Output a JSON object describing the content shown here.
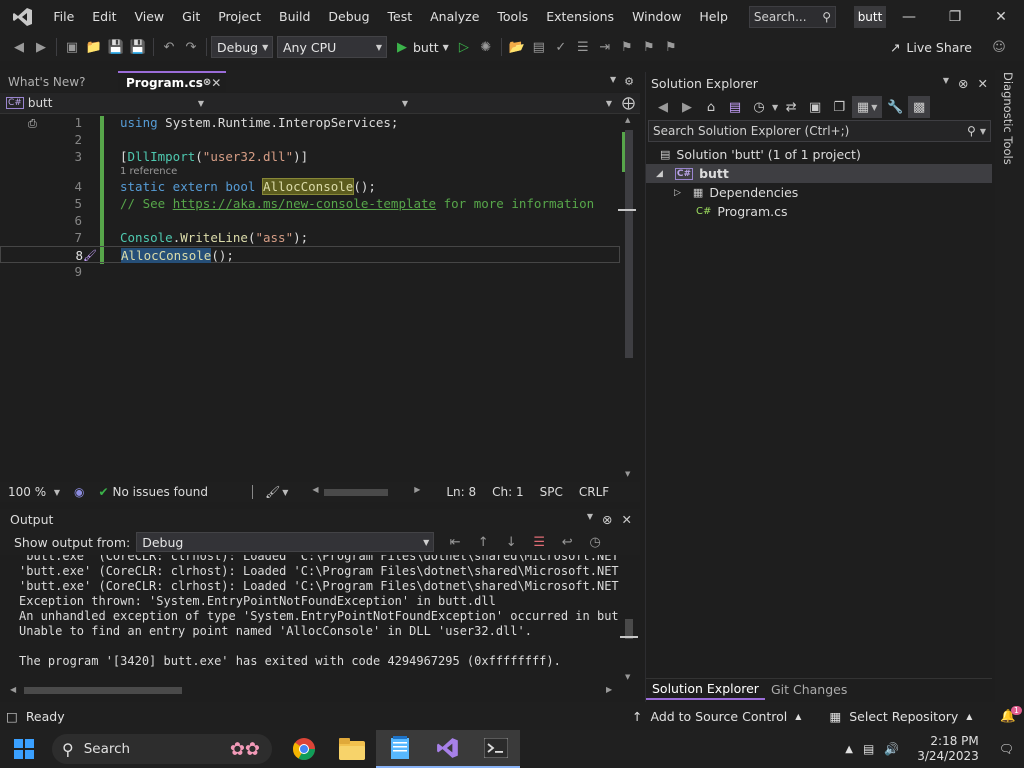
{
  "menu": {
    "items": [
      "File",
      "Edit",
      "View",
      "Git",
      "Project",
      "Build",
      "Debug",
      "Test",
      "Analyze",
      "Tools",
      "Extensions",
      "Window",
      "Help"
    ],
    "search_placeholder": "Search...",
    "solution_name": "butt"
  },
  "toolbar": {
    "config": "Debug",
    "platform": "Any CPU",
    "run_target": "butt",
    "live_share": "Live Share"
  },
  "tabs": [
    {
      "label": "What's New?"
    },
    {
      "label": "Program.cs"
    }
  ],
  "navbar": {
    "project": "butt"
  },
  "editor": {
    "reference_hint": "1 reference",
    "line_numbers": [
      "1",
      "2",
      "3",
      "4",
      "5",
      "6",
      "7",
      "8",
      "9"
    ],
    "l1_kw": "using",
    "l1_rest": " System.Runtime.InteropServices;",
    "l3_open": "[",
    "l3_attr": "DllImport",
    "l3_paren": "(",
    "l3_str": "\"user32.dll\"",
    "l3_close": ")]",
    "l4_kw": "static extern bool",
    "l4_space": " ",
    "l4_fn": "AllocConsole",
    "l4_end": "();",
    "l5_comment": "// See ",
    "l5_link": "https://aka.ms/new-console-template",
    "l5_tail": " for more information",
    "l7_type": "Console",
    "l7_dot": ".",
    "l7_fn": "WriteLine",
    "l7_paren": "(",
    "l7_str": "\"ass\"",
    "l7_end": ");",
    "l8_fn": "AllocConsole",
    "l8_end": "();"
  },
  "status_row": {
    "zoom": "100 %",
    "issues": "No issues found",
    "line": "Ln: 8",
    "col": "Ch: 1",
    "spc": "SPC",
    "eol": "CRLF"
  },
  "output": {
    "title": "Output",
    "show_from_label": "Show output from:",
    "source": "Debug",
    "lines": [
      "'butt.exe' (CoreCLR: clrhost): Loaded 'C:\\Program Files\\dotnet\\shared\\Microsoft.NETCor",
      "'butt.exe' (CoreCLR: clrhost): Loaded 'C:\\Program Files\\dotnet\\shared\\Microsoft.NETCor",
      "'butt.exe' (CoreCLR: clrhost): Loaded 'C:\\Program Files\\dotnet\\shared\\Microsoft.NETCor",
      "Exception thrown: 'System.EntryPointNotFoundException' in butt.dll",
      "An unhandled exception of type 'System.EntryPointNotFoundException' occurred in butt.d",
      "Unable to find an entry point named 'AllocConsole' in DLL 'user32.dll'.",
      "",
      "The program '[3420] butt.exe' has exited with code 4294967295 (0xffffffff)."
    ]
  },
  "solution_explorer": {
    "title": "Solution Explorer",
    "search_placeholder": "Search Solution Explorer (Ctrl+;)",
    "solution_label": "Solution 'butt' (1 of 1 project)",
    "project": "butt",
    "dependencies": "Dependencies",
    "file": "Program.cs",
    "tab_active": "Solution Explorer",
    "tab_other": "Git Changes"
  },
  "diagnostic_tools": "Diagnostic Tools",
  "statusbar": {
    "ready": "Ready",
    "add_source": "Add to Source Control",
    "select_repo": "Select Repository",
    "notif_count": "1"
  },
  "taskbar": {
    "search": "Search",
    "time": "2:18 PM",
    "date": "3/24/2023"
  },
  "colors": {
    "accent": "#9a6cd8",
    "keyword": "#569cd6",
    "type": "#4ec9b0",
    "string": "#d69d85",
    "comment": "#57a64a"
  }
}
